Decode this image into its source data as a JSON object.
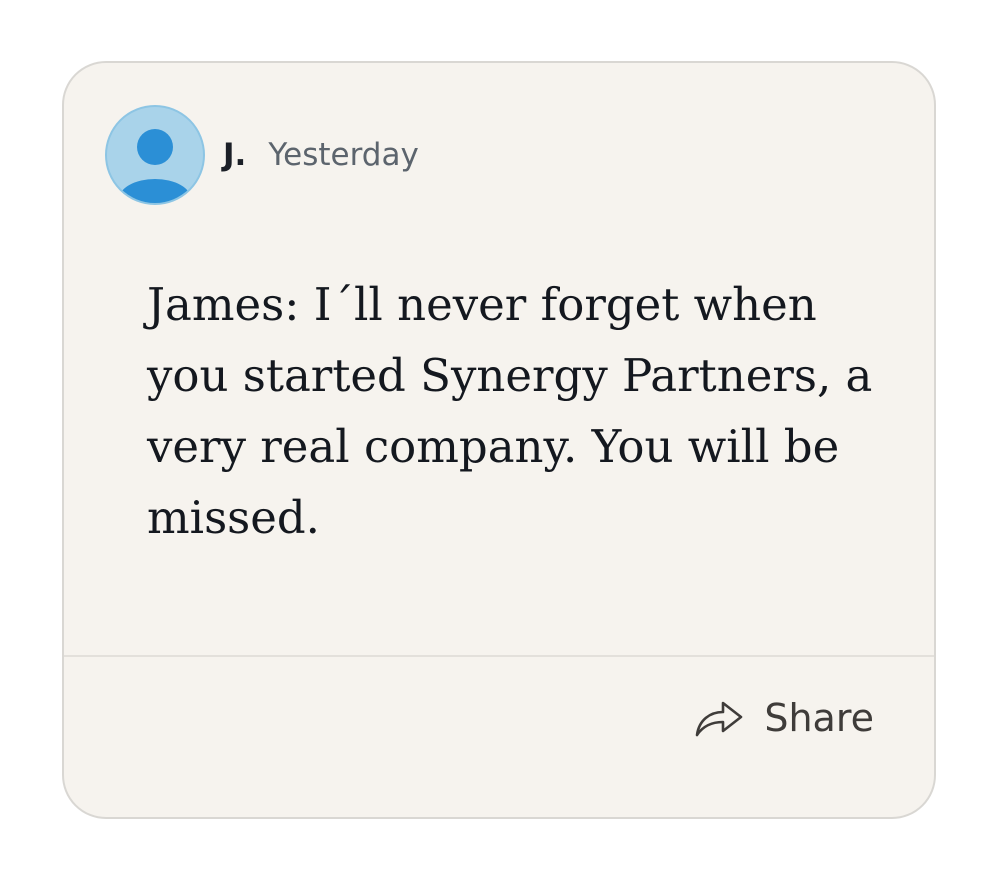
{
  "post": {
    "author": "J.",
    "timestamp": "Yesterday",
    "message": "James: I´ll never forget when you started Synergy Partners, a very real company. You will be missed.",
    "avatar_icon": "user-avatar-icon"
  },
  "footer": {
    "share_label": "Share",
    "share_icon": "share-arrow-icon"
  },
  "colors": {
    "card_background": "#f6f3ee",
    "avatar_background": "#a9d3ea",
    "avatar_figure": "#2b8fd6",
    "text_primary": "#14181f",
    "text_secondary": "#5c646d"
  }
}
